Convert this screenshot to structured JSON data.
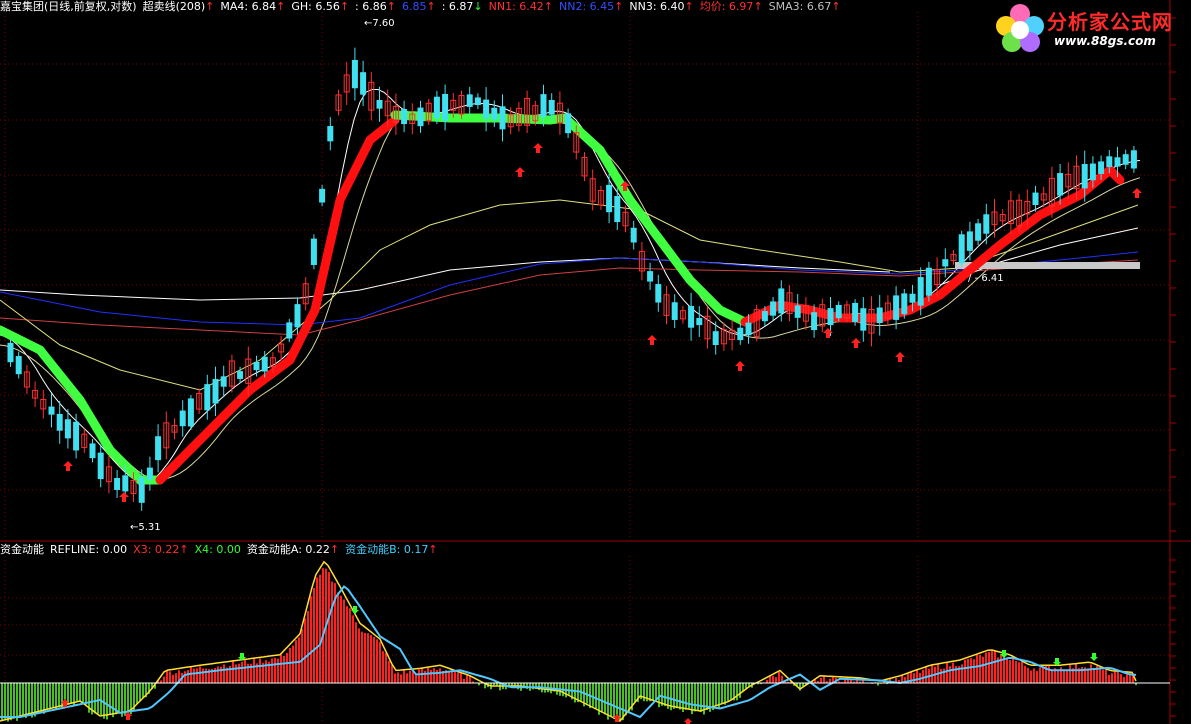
{
  "main_header": {
    "title": "嘉宝集团(日线,前复权,对数)",
    "items": [
      {
        "text": "超卖线(208)",
        "color": "#ffffff",
        "arrow": "↑",
        "arrow_color": "#ff3030"
      },
      {
        "text": "MA4: 6.84",
        "color": "#ffffff",
        "arrow": "↑",
        "arrow_color": "#ff3030"
      },
      {
        "text": "GH: 6.56",
        "color": "#ffffff",
        "arrow": "↑",
        "arrow_color": "#ff3030"
      },
      {
        "text": ": 6.86",
        "color": "#ffffff",
        "arrow": "↑",
        "arrow_color": "#ff3030"
      },
      {
        "text": "6.85",
        "color": "#3050ff",
        "arrow": "↑",
        "arrow_color": "#ff3030"
      },
      {
        "text": ": 6.87",
        "color": "#ffffff",
        "arrow": "↓",
        "arrow_color": "#30ff30"
      },
      {
        "text": "NN1: 6.42",
        "color": "#ff3030",
        "arrow": "↑",
        "arrow_color": "#ff3030"
      },
      {
        "text": "NN2: 6.45",
        "color": "#3050ff",
        "arrow": "↑",
        "arrow_color": "#ff3030"
      },
      {
        "text": "NN3: 6.40",
        "color": "#ffffff",
        "arrow": "↑",
        "arrow_color": "#ff3030"
      },
      {
        "text": "均价: 6.97",
        "color": "#ff3030",
        "arrow": "↑",
        "arrow_color": "#ff3030"
      },
      {
        "text": "SMA3: 6.67",
        "color": "#c0c0c0",
        "arrow": "↑",
        "arrow_color": "#ff3030"
      }
    ]
  },
  "sub_header": {
    "title": "资金动能",
    "items": [
      {
        "text": "REFLINE: 0.00",
        "color": "#ffffff",
        "arrow": "",
        "arrow_color": "#ff3030"
      },
      {
        "text": "X3: 0.22",
        "color": "#ff3030",
        "arrow": "↑",
        "arrow_color": "#ff3030"
      },
      {
        "text": "X4: 0.00",
        "color": "#30ff30",
        "arrow": "",
        "arrow_color": "#ff3030"
      },
      {
        "text": "资金动能A: 0.22",
        "color": "#ffffff",
        "arrow": "↑",
        "arrow_color": "#ff3030"
      },
      {
        "text": "资金动能B: 0.17",
        "color": "#40d0ff",
        "arrow": "↑",
        "arrow_color": "#ff3030"
      }
    ]
  },
  "price_labels": {
    "high": "7.60",
    "low": "5.31",
    "current": "6.41"
  },
  "logo": {
    "name": "分析家公式网",
    "url": "www.88gs.com"
  },
  "colors": {
    "up_candle": "#ff3030",
    "down_candle": "#40e0f0",
    "band_up": "#ff1010",
    "band_down": "#40ff40",
    "grid": "#800000"
  }
}
